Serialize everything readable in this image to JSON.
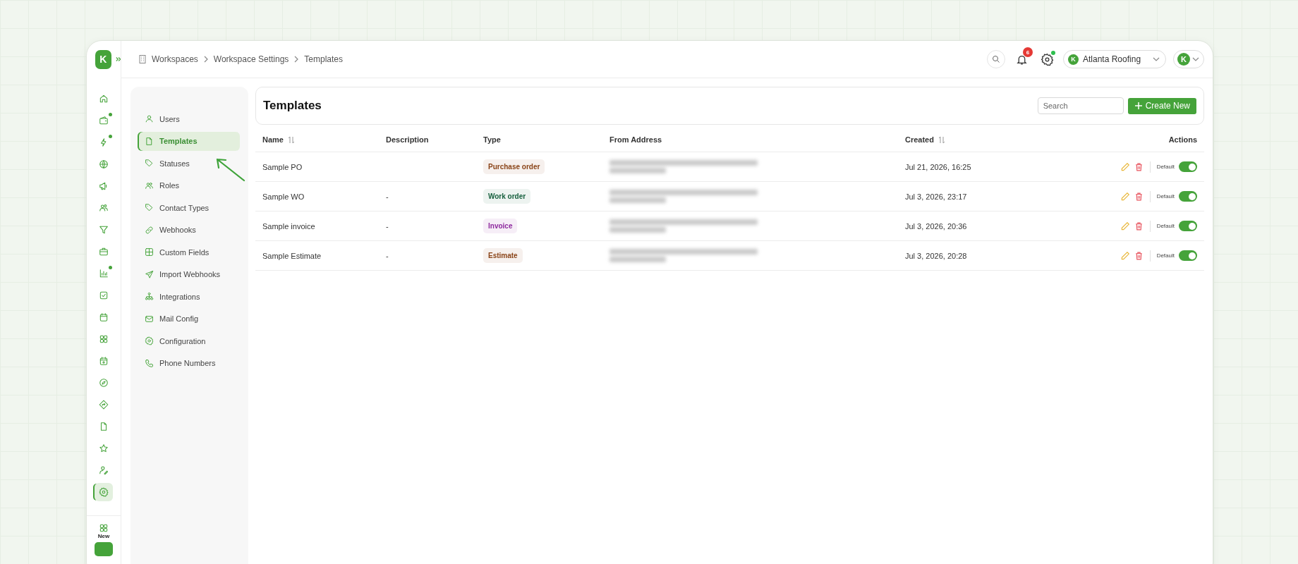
{
  "brand": {
    "letter": "K"
  },
  "rail": {
    "items": [
      {
        "dot": false,
        "selected": false
      },
      {
        "dot": true,
        "selected": false
      },
      {
        "dot": true,
        "selected": false
      },
      {
        "dot": false,
        "selected": false
      },
      {
        "dot": false,
        "selected": false
      },
      {
        "dot": false,
        "selected": false
      },
      {
        "dot": false,
        "selected": false
      },
      {
        "dot": false,
        "selected": false
      },
      {
        "dot": true,
        "selected": false
      },
      {
        "dot": false,
        "selected": false
      },
      {
        "dot": false,
        "selected": false
      },
      {
        "dot": false,
        "selected": false
      },
      {
        "dot": false,
        "selected": false
      },
      {
        "dot": false,
        "selected": false
      },
      {
        "dot": false,
        "selected": false
      },
      {
        "dot": false,
        "selected": false
      },
      {
        "dot": false,
        "selected": false
      },
      {
        "dot": false,
        "selected": false
      },
      {
        "dot": false,
        "selected": true
      }
    ],
    "new_label": "New"
  },
  "breadcrumbs": [
    "Workspaces",
    "Workspace Settings",
    "Templates"
  ],
  "topbar": {
    "notifications": "6",
    "settings_dot": true,
    "workspace": {
      "logo_letter": "K",
      "name": "Atlanta Roofing"
    },
    "avatar": {
      "letter": "K"
    }
  },
  "settings_menu": [
    {
      "label": "Users",
      "selected": false
    },
    {
      "label": "Templates",
      "selected": true
    },
    {
      "label": "Statuses",
      "selected": false
    },
    {
      "label": "Roles",
      "selected": false
    },
    {
      "label": "Contact Types",
      "selected": false
    },
    {
      "label": "Webhooks",
      "selected": false
    },
    {
      "label": "Custom Fields",
      "selected": false
    },
    {
      "label": "Import Webhooks",
      "selected": false
    },
    {
      "label": "Integrations",
      "selected": false
    },
    {
      "label": "Mail Config",
      "selected": false
    },
    {
      "label": "Configuration",
      "selected": false
    },
    {
      "label": "Phone Numbers",
      "selected": false
    }
  ],
  "page": {
    "title": "Templates",
    "search": {
      "placeholder": "Search"
    },
    "create_button": "Create New"
  },
  "table": {
    "columns": [
      {
        "label": "Name",
        "sortable": true
      },
      {
        "label": "Description",
        "sortable": false
      },
      {
        "label": "Type",
        "sortable": false
      },
      {
        "label": "From Address",
        "sortable": false
      },
      {
        "label": "Created",
        "sortable": true
      },
      {
        "label": "Actions",
        "sortable": false
      }
    ],
    "rows": [
      {
        "name": "Sample PO",
        "type": {
          "label": "Purchase order",
          "color": "#8a4418"
        },
        "created": "Jul 21, 2026, 16:25",
        "default_label": "Default",
        "default_on": true
      },
      {
        "name": "Sample WO",
        "description": "-",
        "type": {
          "label": "Work order",
          "color": "#17603e"
        },
        "created": "Jul 3, 2026, 23:17",
        "default_label": "Default",
        "default_on": true
      },
      {
        "name": "Sample invoice",
        "description": "-",
        "type": {
          "label": "Invoice",
          "color": "#8e2a9e"
        },
        "created": "Jul 3, 2026, 20:36",
        "default_label": "Default",
        "default_on": true
      },
      {
        "name": "Sample Estimate",
        "description": "-",
        "type": {
          "label": "Estimate",
          "color": "#8a4418"
        },
        "created": "Jul 3, 2026, 20:28",
        "default_label": "Default",
        "default_on": true
      }
    ]
  }
}
